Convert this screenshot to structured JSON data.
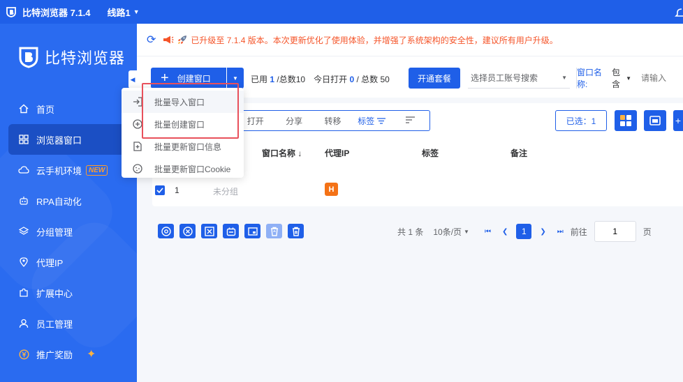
{
  "titlebar": {
    "app_title": "比特浏览器 7.1.4",
    "route": "线路1"
  },
  "sidebar": {
    "logo_text": "比特浏览器",
    "items": [
      {
        "label": "首页",
        "icon": "home-icon"
      },
      {
        "label": "浏览器窗口",
        "icon": "grid-icon",
        "active": true
      },
      {
        "label": "云手机环境",
        "icon": "cloud-icon",
        "badge": "NEW"
      },
      {
        "label": "RPA自动化",
        "icon": "robot-icon"
      },
      {
        "label": "分组管理",
        "icon": "layers-icon"
      },
      {
        "label": "代理IP",
        "icon": "location-icon"
      },
      {
        "label": "扩展中心",
        "icon": "puzzle-icon"
      },
      {
        "label": "员工管理",
        "icon": "user-icon"
      },
      {
        "label": "推广奖励",
        "icon": "yen-icon"
      }
    ]
  },
  "notice": {
    "text": "已升级至 7.1.4 版本。本次更新优化了使用体验，并增强了系统架构的安全性，建议所有用户升级。"
  },
  "toolbar": {
    "create_label": "创建窗口",
    "used_label": "已用",
    "used_value": "1",
    "total_label": "/总数10",
    "today_label": "今日打开",
    "today_value": "0",
    "today_total": "/ 总数 50",
    "plan_label": "开通套餐",
    "staff_placeholder": "选择员工账号搜索",
    "filter_label": "窗口名称:",
    "filter_op": "包含",
    "filter_placeholder": "请输入"
  },
  "dropdown": {
    "items": [
      {
        "label": "批量导入窗口",
        "icon": "import-icon"
      },
      {
        "label": "批量创建窗口",
        "icon": "plus-circle-icon"
      },
      {
        "label": "批量更新窗口信息",
        "icon": "file-update-icon"
      },
      {
        "label": "批量更新窗口Cookie",
        "icon": "cookie-icon"
      }
    ]
  },
  "ops": {
    "open": "打开",
    "share": "分享",
    "transfer": "转移",
    "tags": "标签"
  },
  "selected_label": "已选：1",
  "table": {
    "columns": {
      "name": "窗口名称",
      "proxy": "代理IP",
      "tags": "标签",
      "remark": "备注"
    },
    "rows": [
      {
        "index": "1",
        "group": "未分组",
        "proxy_badge": "H"
      }
    ]
  },
  "pagination": {
    "total": "共 1 条",
    "page_size": "10条/页",
    "current": "1",
    "goto_label": "前往",
    "goto_value": "1",
    "page_suffix": "页"
  },
  "colors": {
    "primary": "#1f5fe8",
    "sidebar": "#2a6bf0",
    "notice": "#f5552a",
    "highlight": "#e8505b",
    "proxy_badge": "#f47216"
  }
}
